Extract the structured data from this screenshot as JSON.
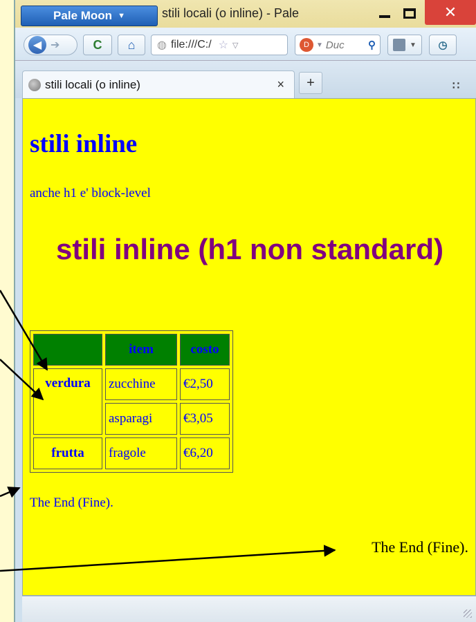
{
  "browser": {
    "app_menu_label": "Pale Moon",
    "window_title": "stili locali (o inline) - Pale",
    "close_glyph": "✕",
    "url": "file:///C:/",
    "search_placeholder": "Duc",
    "tab_title": "stili locali (o inline)",
    "tab_close_glyph": "×",
    "newtab_glyph": "+",
    "tablist_glyph": "∷",
    "icons": [
      "back-icon",
      "forward-icon",
      "reload-icon",
      "home-icon",
      "globe-icon",
      "star-icon",
      "duckduckgo-icon",
      "search-icon",
      "bookmarks-icon",
      "history-icon"
    ]
  },
  "page": {
    "heading": "stili inline",
    "paragraph": "anche h1 e' block-level",
    "heading_big": "stili inline (h1 non standard)",
    "table": {
      "headers": [
        "",
        "item",
        "costo"
      ],
      "rows": [
        {
          "category": "verdura",
          "item": "zucchine",
          "cost": "€2,50"
        },
        {
          "category": "",
          "item": "asparagi",
          "cost": "€3,05"
        },
        {
          "category": "frutta",
          "item": "fragole",
          "cost": "€6,20"
        }
      ]
    },
    "end_text_1": "The End (Fine).",
    "end_text_2": "The End (Fine)."
  },
  "colors": {
    "page_background": "#ffff00",
    "text_blue": "#0000ff",
    "heading_purple": "#800080",
    "table_header_green": "#008000",
    "close_button_red": "#d9433a"
  }
}
